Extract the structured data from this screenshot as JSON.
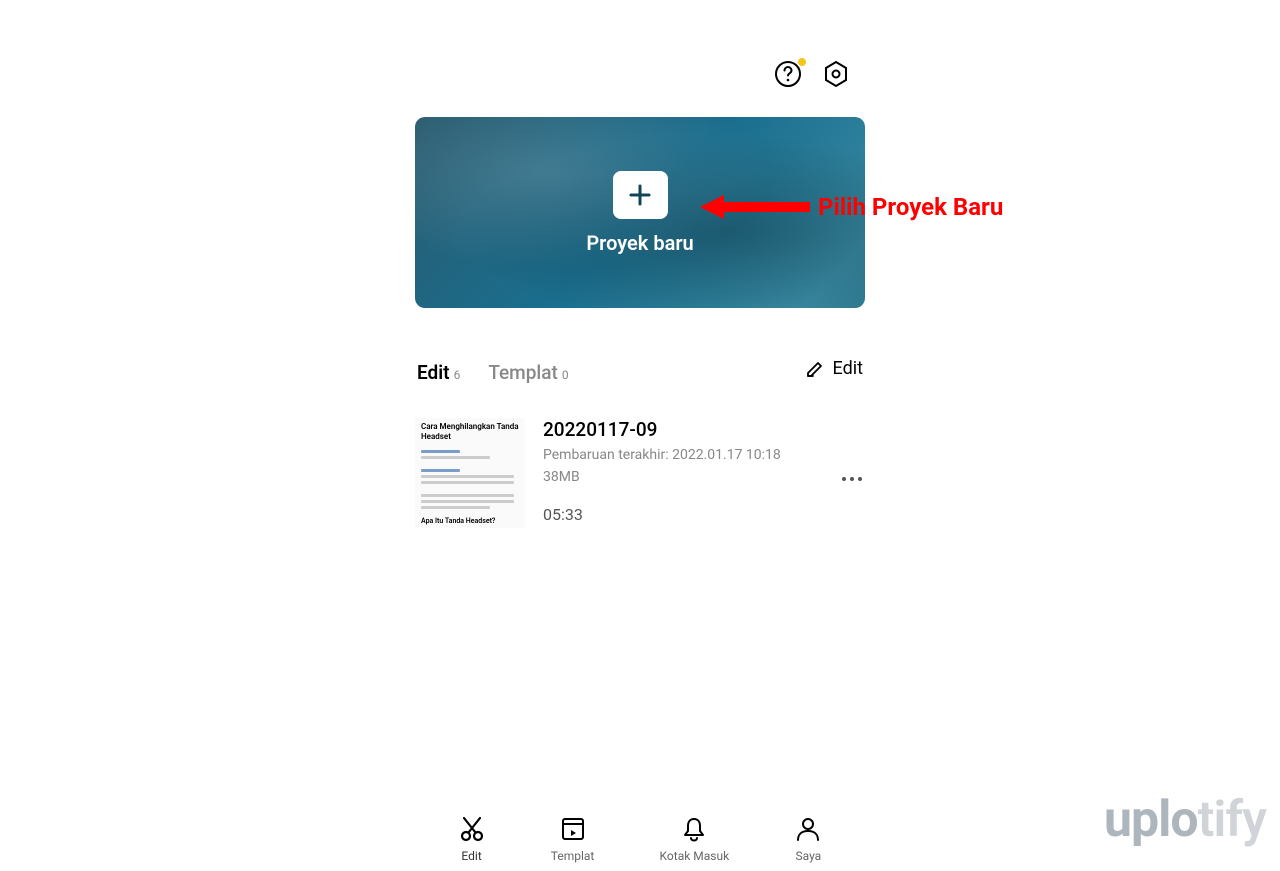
{
  "header": {
    "help_icon": "help-icon",
    "settings_icon": "settings-icon"
  },
  "hero": {
    "label": "Proyek baru"
  },
  "tabs": {
    "edit_label": "Edit",
    "edit_count": "6",
    "templat_label": "Templat",
    "templat_count": "0",
    "edit_action": "Edit"
  },
  "project": {
    "title": "20220117-09",
    "updated": "Pembaruan terakhir: 2022.01.17 10:18",
    "size": "38MB",
    "duration": "05:33",
    "thumb_title": "Cara Menghilangkan Tanda Headset",
    "thumb_sub": "Apa Itu Tanda Headset?"
  },
  "nav": {
    "items": [
      {
        "label": "Edit"
      },
      {
        "label": "Templat"
      },
      {
        "label": "Kotak Masuk"
      },
      {
        "label": "Saya"
      }
    ]
  },
  "annotation": {
    "text": "Pilih Proyek Baru"
  },
  "watermark": {
    "part1": "uplo",
    "part2": "tify"
  }
}
